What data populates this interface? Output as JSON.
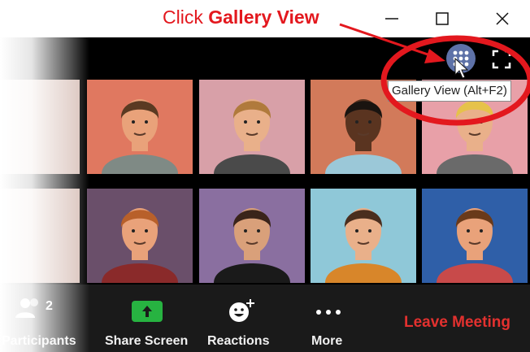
{
  "annotation": {
    "prefix": "Click ",
    "bold": "Gallery View"
  },
  "window_controls": [
    "minimize-icon",
    "maximize-icon",
    "close-icon"
  ],
  "topbar": {
    "gallery_button_icon": "grid-icon",
    "fullscreen_icon": "fullscreen-icon",
    "tooltip": "Gallery View (Alt+F2)"
  },
  "participants": [
    {
      "bg": "#e07860",
      "skin": "#e9a27a",
      "hair": "#5a3a22",
      "shirt": "#7f8a85"
    },
    {
      "bg": "#d8a0a8",
      "skin": "#e9b08a",
      "hair": "#b07a3c",
      "shirt": "#4a4a4a"
    },
    {
      "bg": "#d27a5a",
      "skin": "#5a3420",
      "hair": "#1a1410",
      "shirt": "#9bc8d8"
    },
    {
      "bg": "#e8a0a8",
      "skin": "#e9b08a",
      "hair": "#e6c24a",
      "shirt": "#6a6a6a"
    },
    {
      "bg": "#6a4f6a",
      "skin": "#e9a27a",
      "hair": "#b8602a",
      "shirt": "#8a2a2a"
    },
    {
      "bg": "#8a6fa0",
      "skin": "#d9a07a",
      "hair": "#3a241a",
      "shirt": "#1a1a1a"
    },
    {
      "bg": "#8fc8d8",
      "skin": "#e9b08a",
      "hair": "#4a2e1e",
      "shirt": "#d8862a"
    },
    {
      "bg": "#2f5fa8",
      "skin": "#e9a27a",
      "hair": "#6a3a1a",
      "shirt": "#c84a4a"
    }
  ],
  "toolbar": {
    "participants_count": "2",
    "participants_label": "Participants",
    "share_label": "Share Screen",
    "reactions_label": "Reactions",
    "more_label": "More",
    "leave_label": "Leave Meeting"
  },
  "colors": {
    "annotation_red": "#e3181e",
    "share_green": "#27b341",
    "leave_red": "#e3312f",
    "gallery_button": "#5e72a8"
  }
}
